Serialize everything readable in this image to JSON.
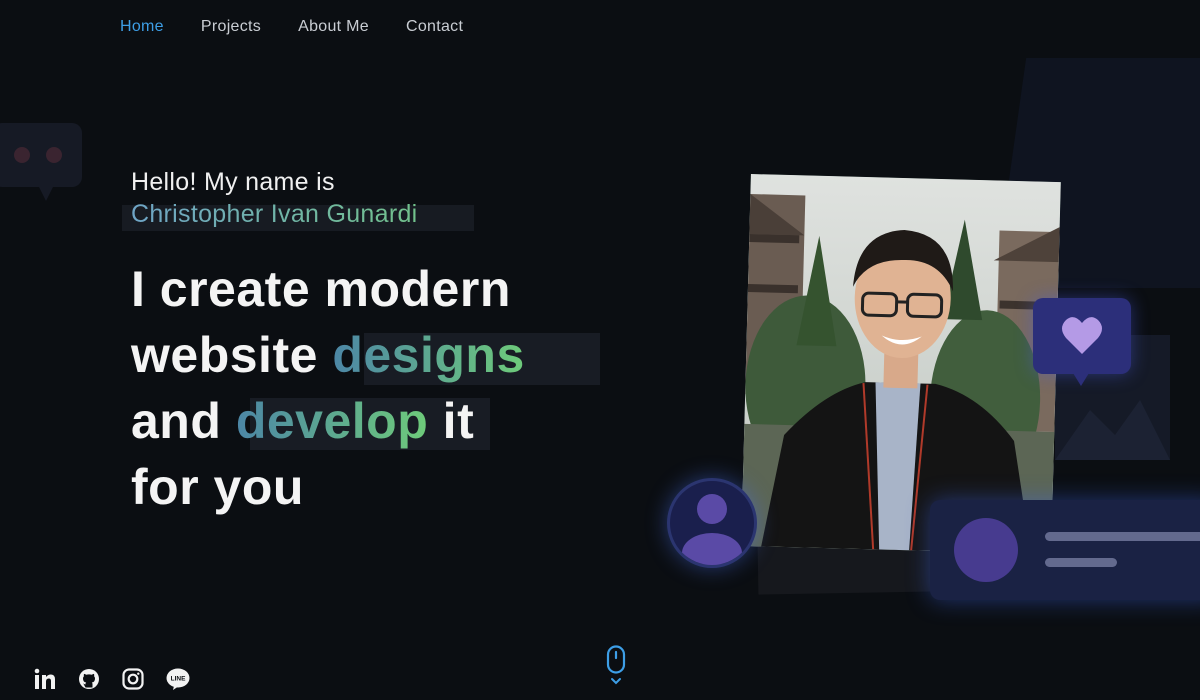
{
  "nav": {
    "items": [
      {
        "label": "Home",
        "active": true
      },
      {
        "label": "Projects",
        "active": false
      },
      {
        "label": "About Me",
        "active": false
      },
      {
        "label": "Contact",
        "active": false
      }
    ]
  },
  "hero": {
    "greeting": "Hello! My name is",
    "name": "Christopher Ivan Gunardi",
    "headline": {
      "line1": "I create modern",
      "line2_pre": "website",
      "line2_highlight": "designs",
      "line3_pre": "and",
      "line3_highlight": "develop",
      "line3_post": "it",
      "line4": "for you"
    }
  },
  "socials": [
    "linkedin-icon",
    "github-icon",
    "instagram-icon",
    "line-icon"
  ],
  "colors": {
    "background": "#0b0e12",
    "accent": "#3d9ee6",
    "gradient_start": "#4c86a6",
    "gradient_end": "#6ecb7a"
  }
}
